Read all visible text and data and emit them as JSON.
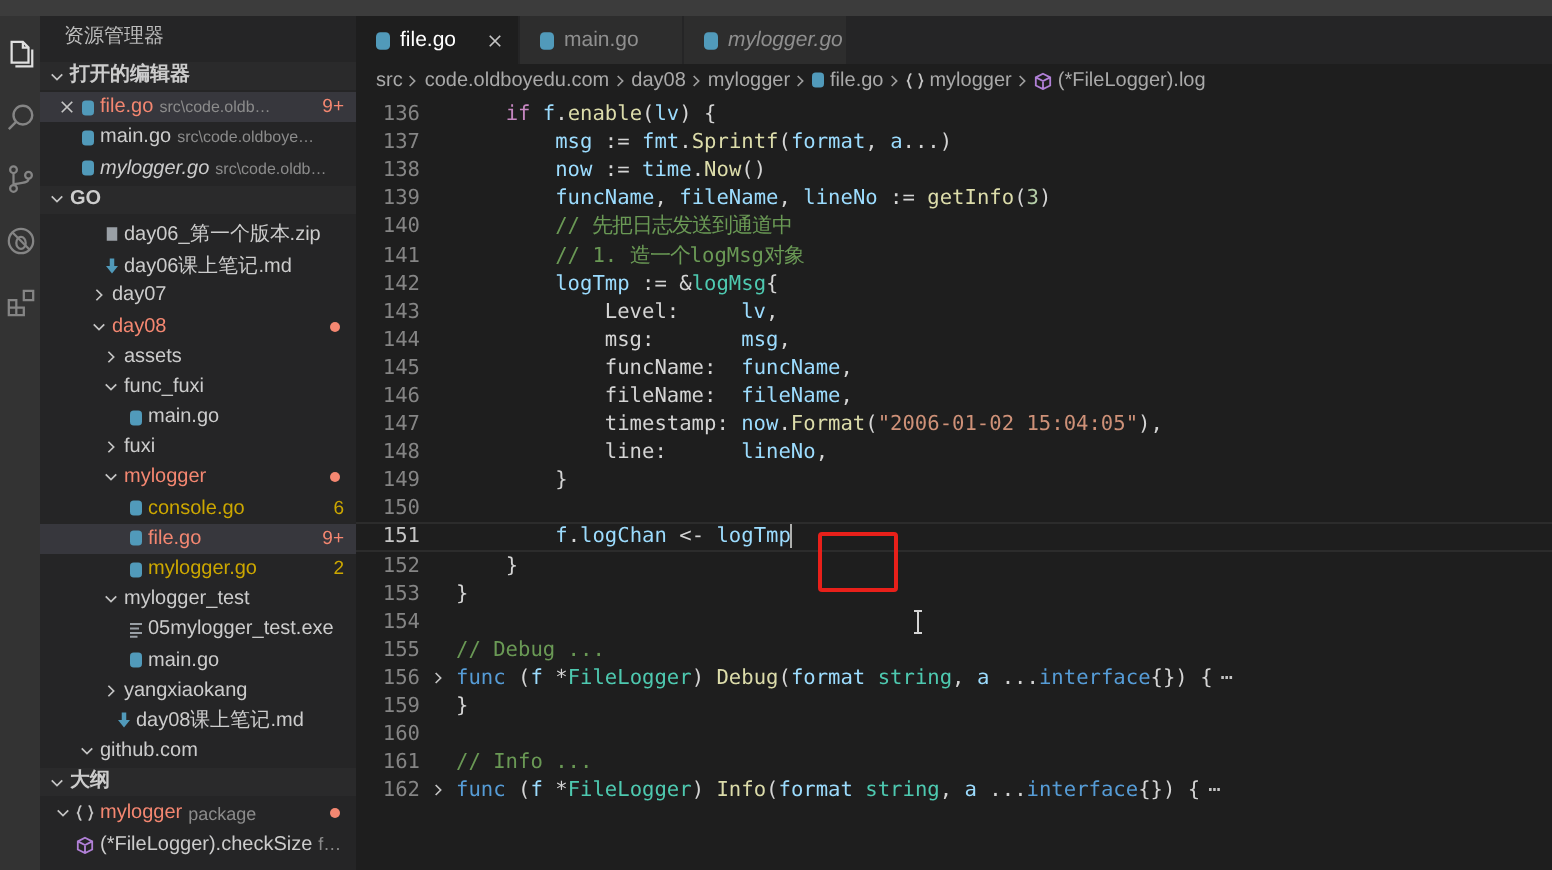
{
  "activity_bar": {
    "items": [
      {
        "kind": "files",
        "selected": true
      },
      {
        "kind": "search",
        "selected": false
      },
      {
        "kind": "branch",
        "selected": false
      },
      {
        "kind": "bug",
        "selected": false
      },
      {
        "kind": "extensions",
        "selected": false
      }
    ]
  },
  "explorer": {
    "title": "资源管理器",
    "open_editors": {
      "title": "打开的编辑器",
      "expanded": true,
      "items": [
        {
          "label": "file.go",
          "path": "src\\code.oldb…",
          "badge": "9+",
          "color": "#f48771",
          "selected": true,
          "preview": false
        },
        {
          "label": "main.go",
          "path": "src\\code.oldboye…",
          "color": "#cccccc",
          "selected": false,
          "preview": false
        },
        {
          "label": "mylogger.go",
          "path": "src\\code.oldb…",
          "color": "#cccccc",
          "selected": false,
          "preview": true
        }
      ]
    },
    "folder": {
      "title": "GO",
      "expanded": true
    },
    "tree": [
      {
        "children": [
          {
            "label": "day06_第一个版本.zip",
            "kind": "zip",
            "color": "#cccccc",
            "selected": false
          },
          {
            "label": "day06课上笔记.md",
            "kind": "md",
            "color": "#cccccc",
            "selected": false
          },
          {
            "label": "day07",
            "kind": "folder",
            "expanded": false,
            "has_problems": false,
            "color": "#cccccc",
            "selected": false
          },
          {
            "label": "day08",
            "kind": "folder",
            "expanded": true,
            "has_problems": true,
            "color": "#f48771",
            "selected": false,
            "children": [
              {
                "label": "assets",
                "kind": "folder",
                "expanded": false,
                "has_problems": false,
                "color": "#cccccc",
                "selected": false
              },
              {
                "label": "func_fuxi",
                "kind": "folder",
                "expanded": true,
                "has_problems": false,
                "color": "#cccccc",
                "selected": false,
                "children": [
                  {
                    "label": "main.go",
                    "kind": "go",
                    "color": "#cccccc",
                    "selected": false
                  }
                ]
              },
              {
                "label": "fuxi",
                "kind": "folder",
                "expanded": false,
                "has_problems": false,
                "color": "#cccccc",
                "selected": false
              },
              {
                "label": "mylogger",
                "kind": "folder",
                "expanded": true,
                "has_problems": true,
                "color": "#f48771",
                "selected": false,
                "children": [
                  {
                    "label": "console.go",
                    "kind": "go",
                    "color": "#cca700",
                    "badge": "6",
                    "selected": false
                  },
                  {
                    "label": "file.go",
                    "kind": "go",
                    "color": "#f48771",
                    "badge": "9+",
                    "selected": true
                  },
                  {
                    "label": "mylogger.go",
                    "kind": "go",
                    "color": "#cca700",
                    "badge": "2",
                    "selected": false
                  }
                ]
              },
              {
                "label": "mylogger_test",
                "kind": "folder",
                "expanded": true,
                "has_problems": false,
                "color": "#cccccc",
                "selected": false,
                "children": [
                  {
                    "label": "05mylogger_test.exe",
                    "kind": "exe",
                    "color": "#cccccc",
                    "selected": false
                  },
                  {
                    "label": "main.go",
                    "kind": "go",
                    "color": "#cccccc",
                    "selected": false
                  }
                ]
              },
              {
                "label": "yangxiaokang",
                "kind": "folder",
                "expanded": false,
                "has_problems": false,
                "color": "#cccccc",
                "selected": false
              },
              {
                "label": "day08课上笔记.md",
                "kind": "md",
                "color": "#cccccc",
                "selected": false
              }
            ]
          }
        ]
      },
      {
        "label": "github.com",
        "kind": "folder",
        "expanded": true,
        "has_problems": false,
        "color": "#cccccc",
        "selected": false
      }
    ],
    "outline": {
      "title": "大纲",
      "expanded": true,
      "items": [
        {
          "label": "mylogger",
          "kind": "braces",
          "detail": "package",
          "expanded": true,
          "has_problems": true,
          "color": "#f48771",
          "selected": false,
          "children": [
            {
              "label": "(*FileLogger).checkSize",
              "kind": "method",
              "detail": "f…",
              "has_problems": false,
              "color": "#cccccc",
              "selected": false
            }
          ]
        }
      ]
    }
  },
  "tabs": [
    {
      "label": "file.go",
      "selected": true,
      "preview": false
    },
    {
      "label": "main.go",
      "selected": false,
      "preview": false
    },
    {
      "label": "mylogger.go",
      "selected": false,
      "preview": true
    }
  ],
  "breadcrumb": [
    {
      "label": "src"
    },
    {
      "label": "code.oldboyedu.com"
    },
    {
      "label": "day08"
    },
    {
      "label": "mylogger"
    },
    {
      "label": "file.go",
      "kind": "go"
    },
    {
      "label": "mylogger",
      "kind": "braces"
    },
    {
      "label": "(*FileLogger).log",
      "kind": "method"
    }
  ],
  "code": {
    "lines": [
      {
        "number": "136",
        "kind": "normal",
        "text": "    if f.enable(lv) {"
      },
      {
        "number": "137",
        "kind": "normal",
        "text": "        msg := fmt.Sprintf(format, a...)"
      },
      {
        "number": "138",
        "kind": "normal",
        "text": "        now := time.Now()"
      },
      {
        "number": "139",
        "kind": "normal",
        "text": "        funcName, fileName, lineNo := getInfo(3)"
      },
      {
        "number": "140",
        "kind": "normal",
        "text": "        // 先把日志发送到通道中"
      },
      {
        "number": "141",
        "kind": "normal",
        "text": "        // 1. 造一个logMsg对象"
      },
      {
        "number": "142",
        "kind": "normal",
        "text": "        logTmp := &logMsg{"
      },
      {
        "number": "143",
        "kind": "normal",
        "text": "            Level:     lv,"
      },
      {
        "number": "144",
        "kind": "normal",
        "text": "            msg:       msg,"
      },
      {
        "number": "145",
        "kind": "normal",
        "text": "            funcName:  funcName,"
      },
      {
        "number": "146",
        "kind": "normal",
        "text": "            fileName:  fileName,"
      },
      {
        "number": "147",
        "kind": "normal",
        "text": "            timestamp: now.Format(\"2006-01-02 15:04:05\"),"
      },
      {
        "number": "148",
        "kind": "normal",
        "text": "            line:      lineNo,"
      },
      {
        "number": "149",
        "kind": "normal",
        "text": "        }"
      },
      {
        "number": "150",
        "kind": "normal"
      },
      {
        "number": "151",
        "kind": "current",
        "text": "        f.logChan <- logTmp"
      },
      {
        "number": "152",
        "kind": "normal",
        "text": "    }"
      },
      {
        "number": "153",
        "kind": "normal",
        "text": "}"
      },
      {
        "number": "154",
        "kind": "normal"
      },
      {
        "number": "155",
        "kind": "normal",
        "text": "// Debug ..."
      },
      {
        "number": "156",
        "kind": "folded",
        "fold_marker": "⋯",
        "text": "func (f *FileLogger) Debug(format string, a ...interface{}) {"
      },
      {
        "number": "159",
        "kind": "normal",
        "text": "}"
      },
      {
        "number": "160",
        "kind": "normal"
      },
      {
        "number": "161",
        "kind": "normal",
        "text": "// Info ..."
      },
      {
        "number": "162",
        "kind": "folded",
        "fold_marker": "⋯",
        "text": "func (f *FileLogger) Info(format string, a ...interface{}) {"
      }
    ]
  },
  "markup": [
    {
      "kind": "rectangle"
    }
  ]
}
